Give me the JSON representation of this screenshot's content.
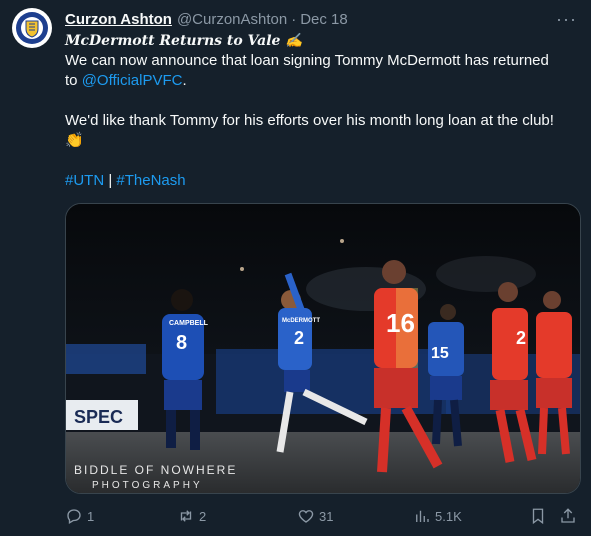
{
  "tweet": {
    "author_name": "Curzon Ashton",
    "author_handle": "@CurzonAshton",
    "separator": "·",
    "date": "Dec 18",
    "more_label": "···",
    "title": "McDermott Returns to Vale ✍",
    "line1": "We can now announce that loan signing Tommy McDermott has returned",
    "line2_prefix": "to ",
    "mention": "@OfficialPVFC",
    "line2_suffix": ".",
    "line3": "We'd like thank Tommy for his efforts over his month long loan at the club!",
    "emoji_clap": "👏",
    "hashtag1": "#UTN",
    "hashtag_sep": " | ",
    "hashtag2": "#TheNash"
  },
  "media": {
    "watermark_line1": "BIDDLE OF NOWHERE",
    "watermark_line2": "PHOTOGRAPHY",
    "sign_text": "SPEC",
    "players": {
      "campbell_name": "CAMPBELL",
      "campbell_number": "8",
      "mcdermott_name": "McDERMOTT",
      "mcdermott_number": "2",
      "red_number": "16",
      "blue2_number": "15",
      "red2_number": "2"
    }
  },
  "actions": {
    "reply_count": "1",
    "retweet_count": "2",
    "like_count": "31",
    "views_count": "5.1K"
  },
  "colors": {
    "background": "#15202b",
    "accent": "#1d9bf0",
    "muted": "#8b98a5"
  }
}
